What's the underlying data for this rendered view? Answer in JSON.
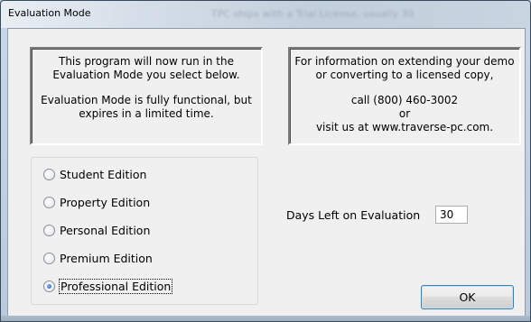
{
  "window": {
    "title": "Evaluation Mode",
    "background_title": "TPC ships with a Trial License, usually 30"
  },
  "info_left": {
    "line1": "This program will now run in the",
    "line2": "Evaluation Mode you select below.",
    "line3": "Evaluation Mode is fully functional, but",
    "line4": "expires in a limited time."
  },
  "info_right": {
    "line1": "For information on extending your demo",
    "line2": "or converting to a licensed copy,",
    "line3": "call (800) 460-3002",
    "line4": "or",
    "line5": "visit us at www.traverse-pc.com."
  },
  "editions": {
    "items": [
      {
        "label": "Student Edition",
        "checked": false
      },
      {
        "label": "Property Edition",
        "checked": false
      },
      {
        "label": "Personal Edition",
        "checked": false
      },
      {
        "label": "Premium Edition",
        "checked": false
      },
      {
        "label": "Professional Edition",
        "checked": true
      }
    ]
  },
  "evaluation": {
    "days_label": "Days Left on Evaluation",
    "days_value": "30"
  },
  "buttons": {
    "ok_label": "OK"
  }
}
